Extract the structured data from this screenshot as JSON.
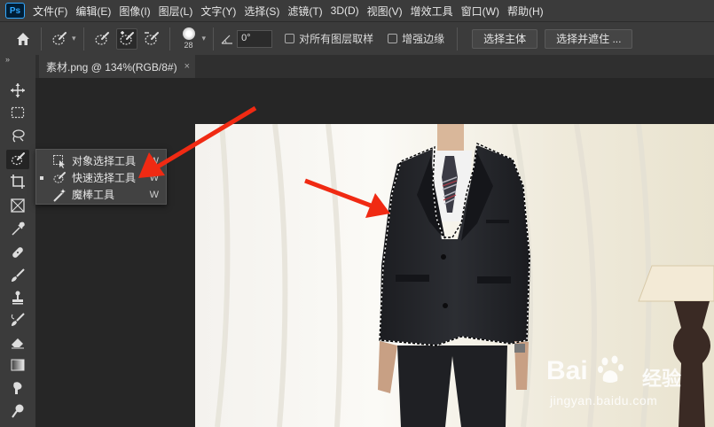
{
  "app": {
    "logo": "Ps"
  },
  "menu": [
    "文件(F)",
    "编辑(E)",
    "图像(I)",
    "图层(L)",
    "文字(Y)",
    "选择(S)",
    "滤镜(T)",
    "3D(D)",
    "视图(V)",
    "增效工具",
    "窗口(W)",
    "帮助(H)"
  ],
  "options": {
    "brush_size": "28",
    "angle_value": "0°",
    "sample_all_layers_label": "对所有图层取样",
    "enhance_edge_label": "增强边缘",
    "select_subject_label": "选择主体",
    "select_and_mask_label": "选择并遮住 ..."
  },
  "document_tab": {
    "title": "素材.png @ 134%(RGB/8#)",
    "close": "×"
  },
  "toolbar": {
    "collapse": "»"
  },
  "flyout": {
    "items": [
      {
        "label": "对象选择工具",
        "key": "W"
      },
      {
        "label": "快速选择工具",
        "key": "W"
      },
      {
        "label": "魔棒工具",
        "key": "W"
      }
    ]
  },
  "watermark": {
    "logo": "Bai",
    "brand": "经验",
    "url": "jingyan.baidu.com"
  },
  "colors": {
    "panel": "#3b3b3b",
    "canvas": "#262626",
    "arrow": "#f02a13",
    "accent": "#31a8ff"
  }
}
